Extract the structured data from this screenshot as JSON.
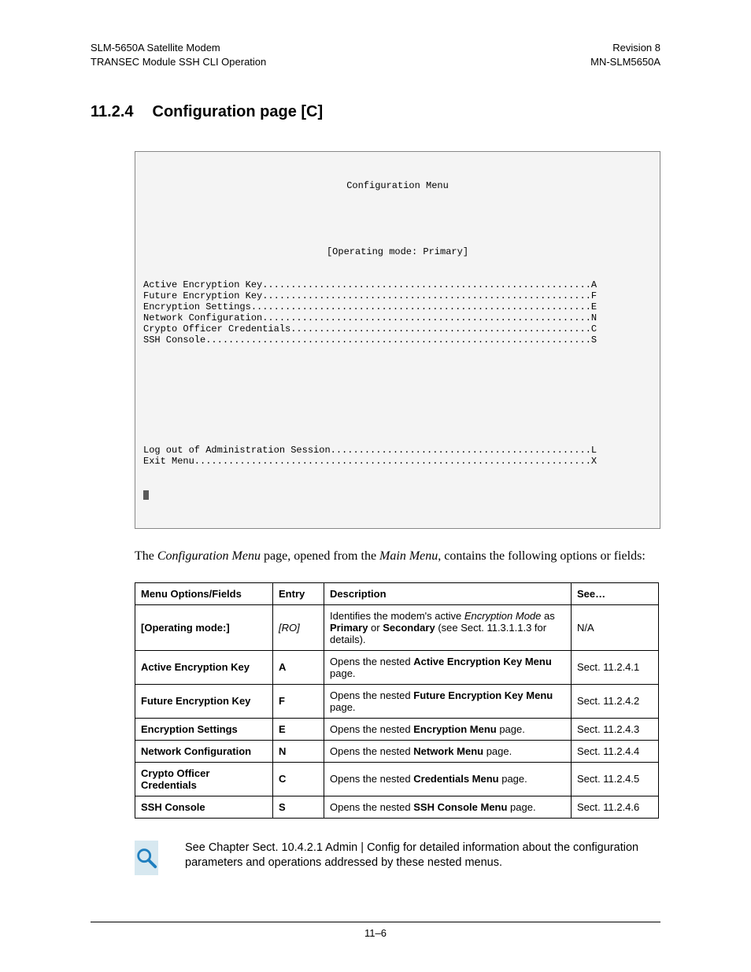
{
  "header": {
    "left1": "SLM-5650A Satellite Modem",
    "left2": "TRANSEC Module SSH CLI Operation",
    "right1": "Revision 8",
    "right2": "MN-SLM5650A"
  },
  "heading": {
    "num": "11.2.4",
    "text": "Configuration page [C]"
  },
  "console": {
    "title": "Configuration Menu",
    "sub": "[Operating mode: Primary]",
    "lines_top": [
      "Active Encryption Key..........................................................A",
      "Future Encryption Key..........................................................F",
      "Encryption Settings............................................................E",
      "Network Configuration..........................................................N",
      "Crypto Officer Credentials.....................................................C",
      "SSH Console....................................................................S"
    ],
    "lines_bottom": [
      "Log out of Administration Session..............................................L",
      "Exit Menu......................................................................X"
    ]
  },
  "intro": {
    "a": "The ",
    "b": "Configuration Menu",
    "c": " page, opened from the ",
    "d": "Main Menu",
    "e": ", contains the following options or fields:"
  },
  "table": {
    "headers": {
      "menu": "Menu Options/Fields",
      "entry": "Entry",
      "desc": "Description",
      "see": "See…"
    },
    "rows": [
      {
        "menu_bold": "[Operating mode:]",
        "entry_ital": "[RO]",
        "desc_parts": [
          "Identifies the modem's active ",
          "Encryption Mode",
          " as ",
          "Primary",
          " or ",
          "Secondary",
          " (see Sect. 11.3.1.1.3 for details)."
        ],
        "desc_styles": [
          "",
          "i",
          "",
          "b",
          "",
          "b",
          ""
        ],
        "see": "N/A"
      },
      {
        "menu_bold": "Active Encryption Key",
        "entry_bold": "A",
        "desc_parts": [
          "Opens the nested ",
          "Active Encryption Key Menu",
          " page."
        ],
        "desc_styles": [
          "",
          "b",
          ""
        ],
        "see": "Sect. 11.2.4.1"
      },
      {
        "menu_bold": "Future Encryption Key",
        "entry_bold": "F",
        "desc_parts": [
          "Opens the nested ",
          "Future Encryption Key Menu",
          " page."
        ],
        "desc_styles": [
          "",
          "b",
          ""
        ],
        "see": "Sect. 11.2.4.2"
      },
      {
        "menu_bold": "Encryption Settings",
        "entry_bold": "E",
        "desc_parts": [
          "Opens the nested ",
          "Encryption Menu",
          " page."
        ],
        "desc_styles": [
          "",
          "b",
          ""
        ],
        "see": "Sect. 11.2.4.3"
      },
      {
        "menu_bold": "Network Configuration",
        "entry_bold": "N",
        "desc_parts": [
          "Opens the nested ",
          "Network Menu",
          " page."
        ],
        "desc_styles": [
          "",
          "b",
          ""
        ],
        "see": "Sect. 11.2.4.4"
      },
      {
        "menu_bold": "Crypto Officer Credentials",
        "entry_bold": "C",
        "desc_parts": [
          "Opens the nested ",
          "Credentials Menu",
          " page."
        ],
        "desc_styles": [
          "",
          "b",
          ""
        ],
        "see": "Sect. 11.2.4.5"
      },
      {
        "menu_bold": "SSH Console",
        "entry_bold": "S",
        "desc_parts": [
          "Opens the nested ",
          "SSH Console Menu",
          " page."
        ],
        "desc_styles": [
          "",
          "b",
          ""
        ],
        "see": "Sect. 11.2.4.6"
      }
    ]
  },
  "note": "See Chapter Sect. 10.4.2.1 Admin | Config for detailed information about the configuration parameters and operations addressed by these nested menus.",
  "footer": "11–6"
}
